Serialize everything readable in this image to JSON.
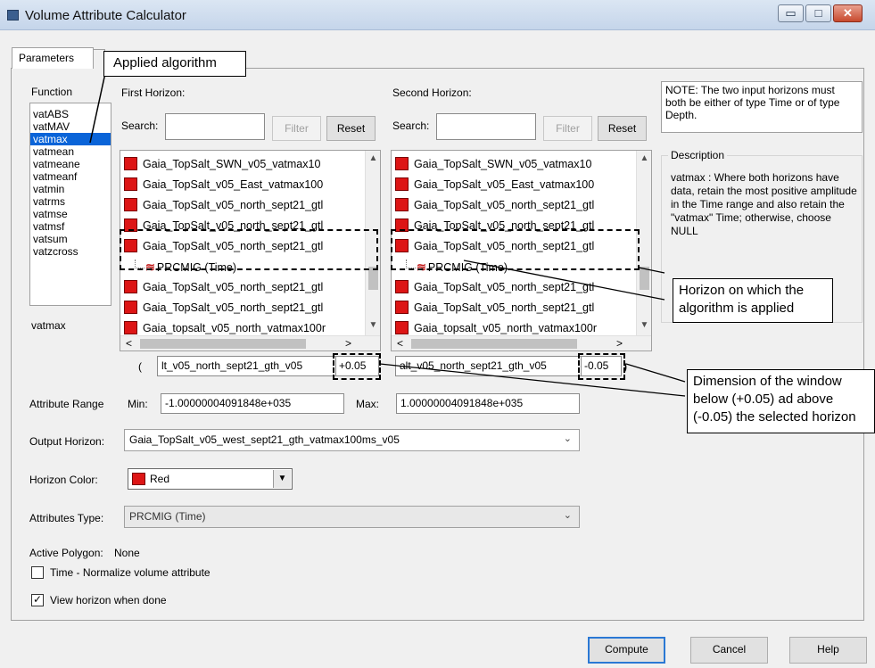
{
  "window": {
    "title": "Volume Attribute Calculator",
    "minimize_glyph": "▭",
    "maximize_glyph": "□",
    "close_glyph": "✕"
  },
  "tabs": [
    {
      "label": "Parameters"
    }
  ],
  "function": {
    "label": "Function",
    "items": [
      "vatABS",
      "vatMAV",
      "vatmax",
      "vatmean",
      "vatmeane",
      "vatmeanf",
      "vatmin",
      "vatrms",
      "vatmse",
      "vatmsf",
      "vatsum",
      "vatzcross"
    ],
    "selected": "vatmax",
    "selected_display": "vatmax"
  },
  "first_horizon": {
    "label": "First Horizon:",
    "search_label": "Search:",
    "search_value": "",
    "filter_label": "Filter",
    "reset_label": "Reset",
    "items": [
      {
        "name": "Gaia_TopSalt_SWN_v05_vatmax10"
      },
      {
        "name": "Gaia_TopSalt_v05_East_vatmax100"
      },
      {
        "name": "Gaia_TopSalt_v05_north_sept21_gtl"
      },
      {
        "name": "Gaia_TopSalt_v05_north_sept21_gtl"
      },
      {
        "name": "Gaia_TopSalt_v05_north_sept21_gtl"
      },
      {
        "name": "PRCMIG (Time)",
        "child": true
      },
      {
        "name": "Gaia_TopSalt_v05_north_sept21_gtl"
      },
      {
        "name": "Gaia_TopSalt_v05_north_sept21_gtl"
      },
      {
        "name": "Gaia_topsalt_v05_north_vatmax100r"
      }
    ],
    "selected_value": "lt_v05_north_sept21_gth_v05",
    "offset": "+0.05",
    "paren": "("
  },
  "second_horizon": {
    "label": "Second Horizon:",
    "search_label": "Search:",
    "search_value": "",
    "filter_label": "Filter",
    "reset_label": "Reset",
    "items": [
      {
        "name": "Gaia_TopSalt_SWN_v05_vatmax10"
      },
      {
        "name": "Gaia_TopSalt_v05_East_vatmax100"
      },
      {
        "name": "Gaia_TopSalt_v05_north_sept21_gtl"
      },
      {
        "name": "Gaia_TopSalt_v05_north_sept21_gtl"
      },
      {
        "name": "Gaia_TopSalt_v05_north_sept21_gtl"
      },
      {
        "name": "PRCMIG (Time)",
        "child": true
      },
      {
        "name": "Gaia_TopSalt_v05_north_sept21_gtl"
      },
      {
        "name": "Gaia_TopSalt_v05_north_sept21_gtl"
      },
      {
        "name": "Gaia_topsalt_v05_north_vatmax100r"
      }
    ],
    "selected_value": "alt_v05_north_sept21_gth_v05",
    "offset": "-0.05",
    "paren": ")"
  },
  "note": "NOTE: The two input horizons must both be either of type Time or of type Depth.",
  "description": {
    "title": "Description",
    "text": "vatmax : Where both horizons have data, retain the most positive amplitude in the Time range and also retain the \"vatmax\" Time; otherwise, choose NULL"
  },
  "attribute_range": {
    "label": "Attribute Range",
    "min_label": "Min:",
    "min_value": "-1.00000004091848e+035",
    "max_label": "Max:",
    "max_value": "1.00000004091848e+035"
  },
  "output_horizon": {
    "label": "Output Horizon:",
    "value": "Gaia_TopSalt_v05_west_sept21_gth_vatmax100ms_v05"
  },
  "horizon_color": {
    "label": "Horizon Color:",
    "value": "Red",
    "swatch": "#dd1515"
  },
  "attributes_type": {
    "label": "Attributes Type:",
    "value": "PRCMIG (Time)"
  },
  "active_polygon": {
    "label": "Active Polygon:",
    "value": "None"
  },
  "options": {
    "normalize_label": "Time - Normalize volume attribute",
    "normalize_checked": false,
    "view_label": "View horizon when done",
    "view_checked": true
  },
  "buttons": {
    "compute": "Compute",
    "cancel": "Cancel",
    "help": "Help"
  },
  "annotations": {
    "applied_algorithm": "Applied algorithm",
    "horizon_note": "Horizon on which the algorithm is applied",
    "window_note": "Dimension of the window below (+0.05) ad above (-0.05) the selected horizon"
  },
  "colors": {
    "selection": "#0a64d8",
    "horizon_swatch": "#dd1515",
    "titlebar": "#c5d5ea",
    "close_button": "#c74a2e"
  },
  "icons": {
    "horizon_item": "red-square-icon",
    "seismic": "seismic-wave-icon",
    "dropdown": "chevron-down-icon"
  }
}
